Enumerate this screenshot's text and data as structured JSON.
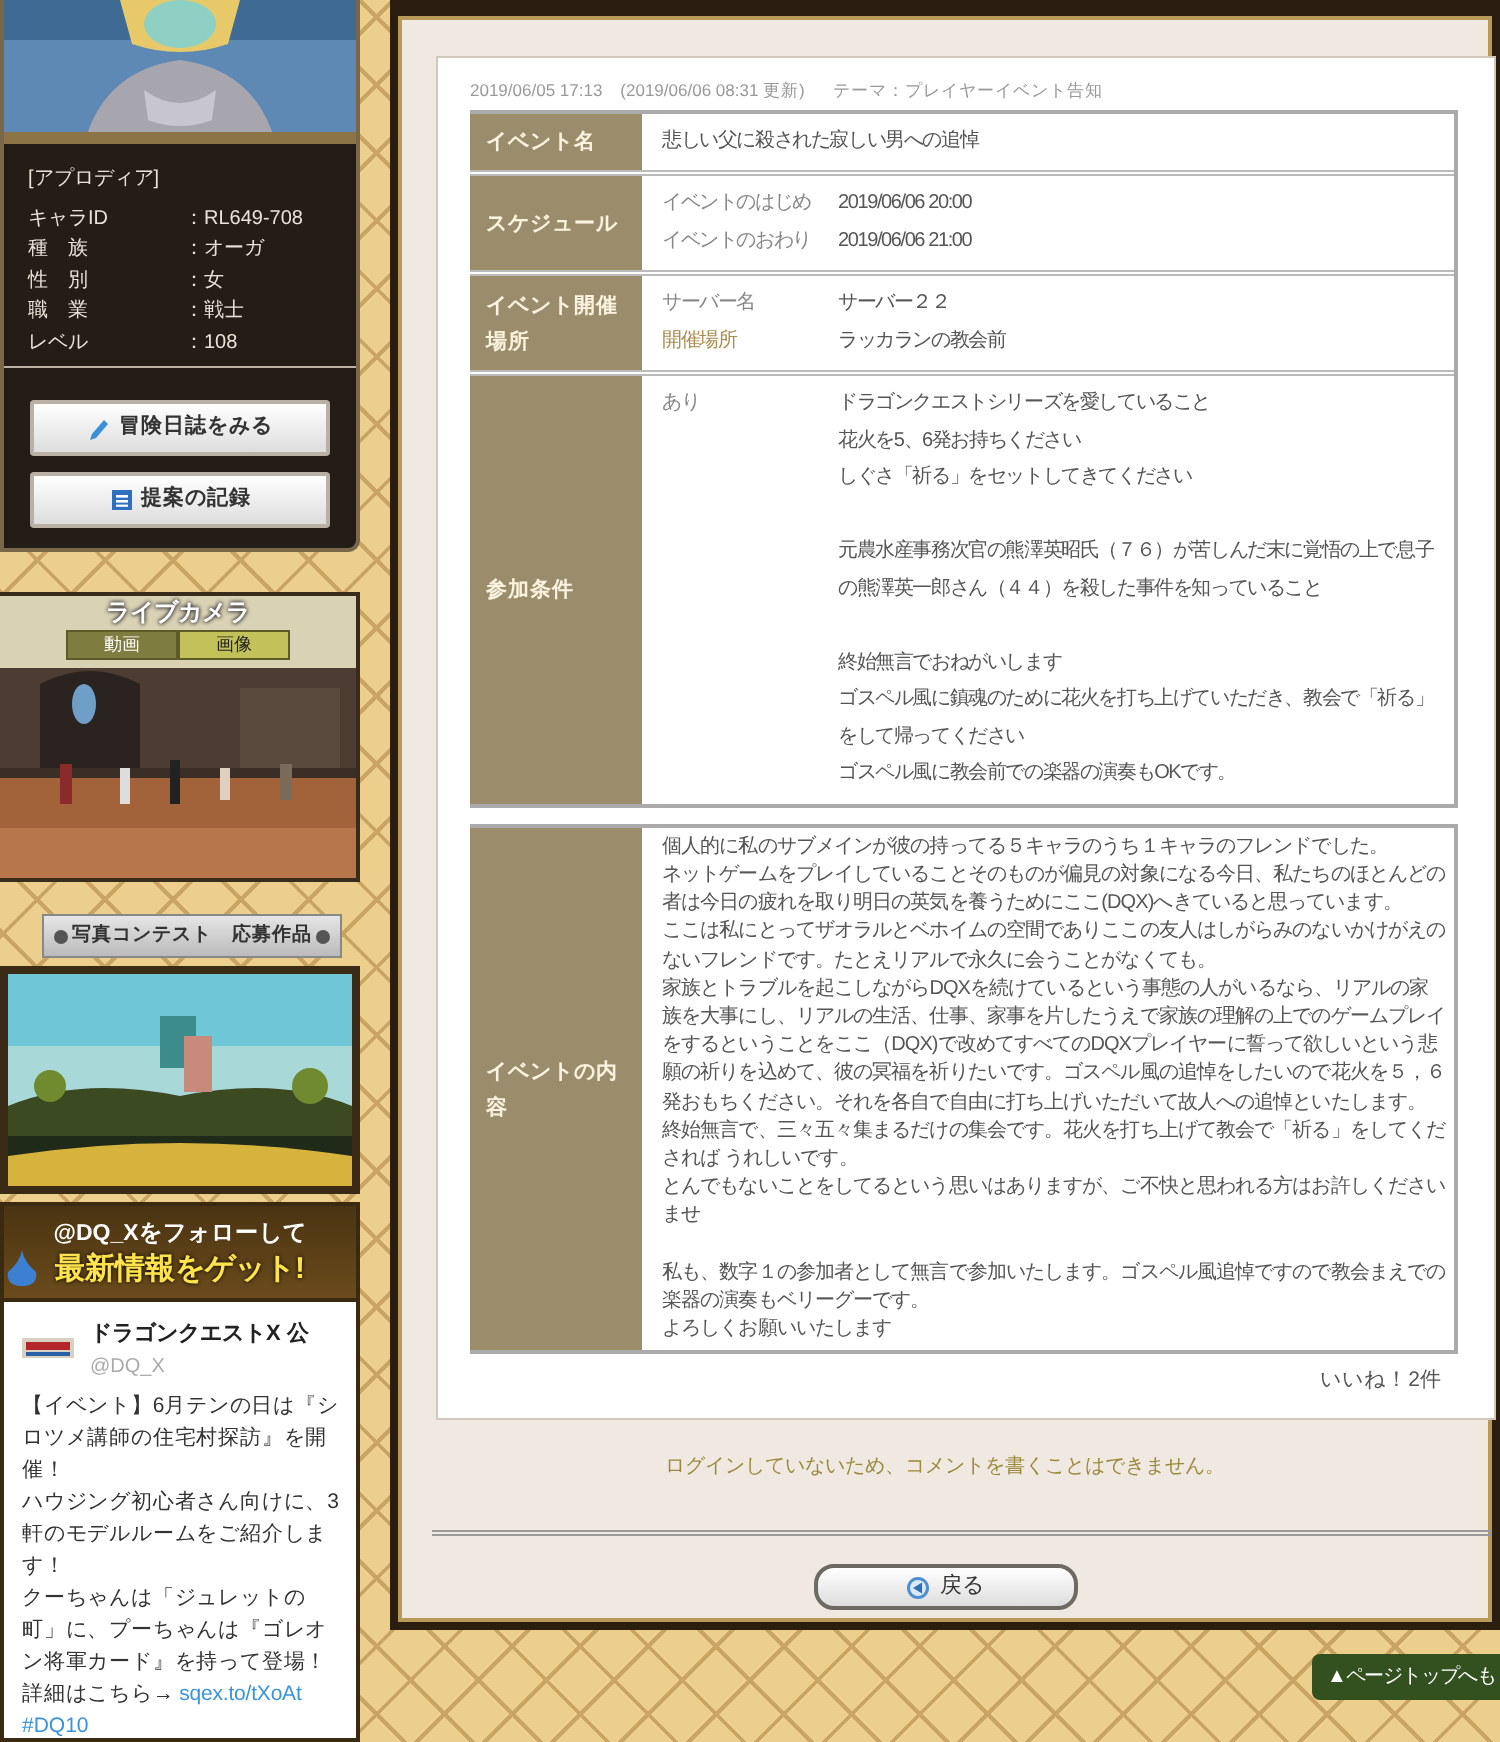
{
  "character_panel": {
    "name": "[アプロディア]",
    "stats": [
      {
        "label": "キャラID",
        "value": "：RL649-708"
      },
      {
        "label": "種　族",
        "value": "：オーガ"
      },
      {
        "label": "性　別",
        "value": "：女"
      },
      {
        "label": "職　業",
        "value": "：戦士"
      },
      {
        "label": "レベル",
        "value": "：108"
      }
    ],
    "buttons": [
      {
        "label": "冒険日誌をみる",
        "kind": "pen"
      },
      {
        "label": "提案の記録",
        "kind": "list"
      }
    ]
  },
  "live_camera": {
    "title": "ライブカメラ",
    "tabs": [
      {
        "label": "動画",
        "selected": false
      },
      {
        "label": "画像",
        "selected": true
      }
    ]
  },
  "photo_contest": {
    "title": "写真コンテスト　応募作品"
  },
  "twitter_banner": {
    "line_1": "@DQ_Xをフォローして",
    "line_2": "最新情報をゲット!"
  },
  "tweet": {
    "author": "ドラゴンクエストX 公",
    "handle": "@DQ_X",
    "lines": [
      {
        "text": "【イベント】6月テンの日は『シロツメ講師の住宅村探訪』を開催！"
      },
      {
        "text": "ハウジング初心者さん向けに、3軒のモデルルームをご紹介します！"
      },
      {
        "text": "クーちゃんは「ジュレットの町」に、プーちゃんは『ゴレオン将軍カード』を持って登場！"
      },
      {
        "text": "詳細はこちら→ ",
        "link": "sqex.to/tXoAt"
      },
      {
        "link": "#DQ10"
      }
    ]
  },
  "post": {
    "meta": "2019/06/05 17:13　(2019/06/06 08:31 更新)",
    "theme": "テーマ：プレイヤーイベント告知",
    "details": [
      {
        "kind": "single",
        "label": "イベント名",
        "value": "悲しい父に殺された寂しい男への追悼"
      },
      {
        "kind": "pairs",
        "label": "スケジュール",
        "pairs": [
          {
            "key": "イベントのはじめ",
            "value": "2019/06/06 20:00",
            "highlighted": false
          },
          {
            "key": "イベントのおわり",
            "value": "2019/06/06 21:00",
            "highlighted": false
          }
        ]
      },
      {
        "kind": "pairs",
        "label": "イベント開催場所",
        "pairs": [
          {
            "key": "サーバー名",
            "value": "サーバー２２",
            "highlighted": false
          },
          {
            "key": "開催場所",
            "value": "ラッカランの教会前",
            "highlighted": true
          }
        ]
      },
      {
        "kind": "conditions",
        "label": "参加条件",
        "key": "あり",
        "blocks": [
          [
            "ドラゴンクエストシリーズを愛していること",
            "花火を5、6発お持ちください",
            "しぐさ「祈る」をセットしてきてください"
          ],
          [
            "元農水産事務次官の熊澤英昭氏（７６）が苦しんだ末に覚悟の上で息子の熊澤英一郎さん（４４）を殺した事件を知っていること"
          ],
          [
            "終始無言でおねがいします",
            "ゴスペル風に鎮魂のために花火を打ち上げていただき、教会で「祈る」をして帰ってください",
            "ゴスペル風に教会前での楽器の演奏もOKです。"
          ]
        ]
      }
    ],
    "description": {
      "label": "イベントの内容",
      "blocks": [
        [
          "個人的に私のサブメインが彼の持ってる５キャラのうち１キャラのフレンドでした。",
          "ネットゲームをプレイしていることそのものが偏見の対象になる今日、私たちのほとんどの者は今日の疲れを取り明日の英気を養うためにここ(DQX)へきていると思っています。",
          "ここは私にとってザオラルとベホイムの空間でありここの友人はしがらみのないかけがえのないフレンドです。たとえリアルで永久に会うことがなくても。",
          "家族とトラブルを起こしながらDQXを続けているという事態の人がいるなら、リアルの家族を大事にし、リアルの生活、仕事、家事を片したうえで家族の理解の上でのゲームプレイをするということをここ（DQX)で改めてすべてのDQXプレイヤーに誓って欲しいという悲願の祈りを込めて、彼の冥福を祈りたいです。ゴスペル風の追悼をしたいので花火を５，６発おもちください。それを各自で自由に打ち上げいただいて故人への追悼といたします。",
          "終始無言で、三々五々集まるだけの集会です。花火を打ち上げて教会で「祈る」をしてくだされば うれしいです。",
          "とんでもないことをしてるという思いはありますが、ご不快と思われる方はお許しくださいませ"
        ],
        [
          "私も、数字１の参加者として無言で参加いたします。ゴスペル風追悼ですので教会まえでの楽器の演奏もベリーグーです。",
          "よろしくお願いいたします"
        ]
      ]
    },
    "likes": "いいね！2件"
  },
  "comment_notice": "ログインしていないため、コメントを書くことはできません。",
  "back_button": "戻る",
  "page_top_button": "▲ページトップへも"
}
